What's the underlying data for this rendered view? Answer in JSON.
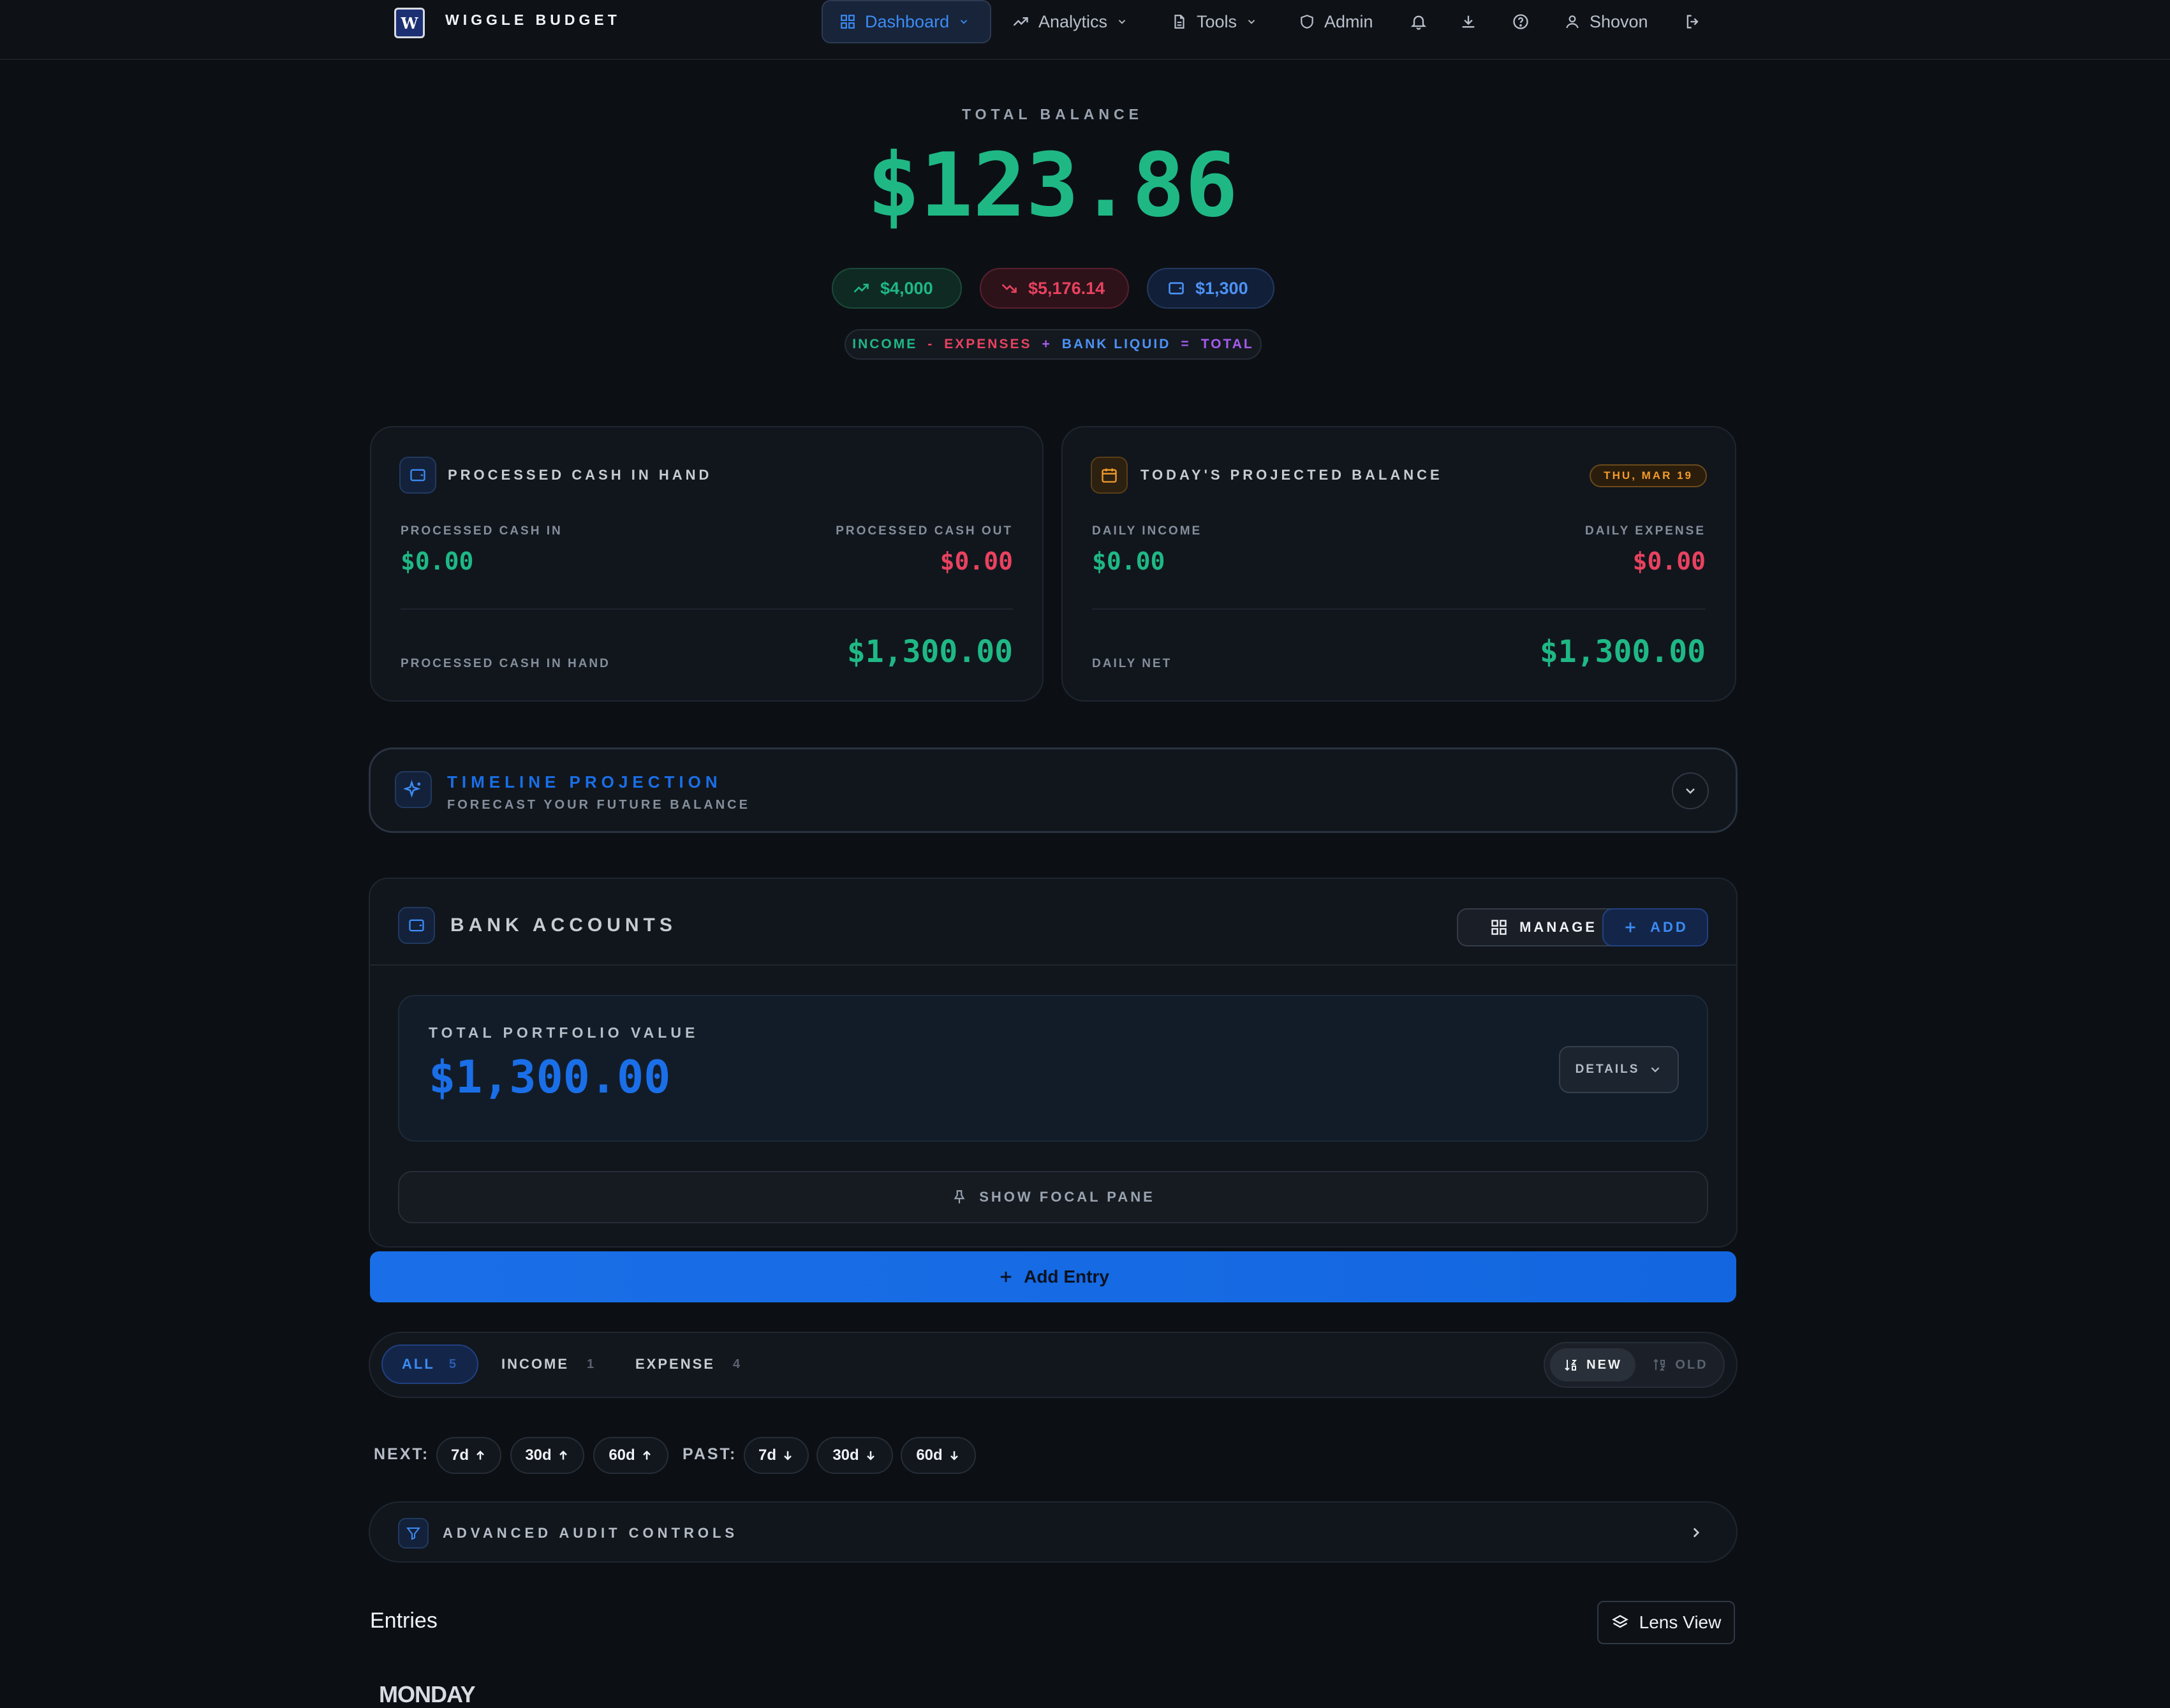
{
  "colors": {
    "accent_blue": "#1a6fe8",
    "income_green": "#1fb885",
    "expense_red": "#e8425f",
    "purple": "#a55cf0",
    "orange": "#f39b2c",
    "background": "#0c1015"
  },
  "nav": {
    "brand": "WIGGLE BUDGET",
    "logo_text": "W",
    "items": [
      {
        "label": "Dashboard",
        "icon": "grid-icon"
      },
      {
        "label": "Analytics",
        "icon": "trending-up-icon"
      },
      {
        "label": "Tools",
        "icon": "document-icon"
      },
      {
        "label": "Admin",
        "icon": "shield-icon"
      }
    ],
    "user": "Shovon"
  },
  "hero": {
    "label": "TOTAL BALANCE",
    "value": "$123.86",
    "pills": {
      "income": "$4,000",
      "expenses": "$5,176.14",
      "bank": "$1,300"
    },
    "formula": {
      "income": "INCOME",
      "minus": "-",
      "expenses": "EXPENSES",
      "plus": "+",
      "bank": "BANK LIQUID",
      "equals": "=",
      "total": "TOTAL"
    }
  },
  "cash_card": {
    "title": "PROCESSED CASH IN HAND",
    "in_label": "PROCESSED CASH IN",
    "in_value": "$0.00",
    "out_label": "PROCESSED CASH OUT",
    "out_value": "$0.00",
    "total_label": "PROCESSED CASH IN HAND",
    "total_value": "$1,300.00"
  },
  "projected_card": {
    "title": "TODAY'S PROJECTED BALANCE",
    "date_badge": "THU, MAR 19",
    "income_label": "DAILY INCOME",
    "income_value": "$0.00",
    "expense_label": "DAILY EXPENSE",
    "expense_value": "$0.00",
    "net_label": "DAILY NET",
    "net_value": "$1,300.00"
  },
  "timeline": {
    "title": "TIMELINE PROJECTION",
    "subtitle": "FORECAST YOUR FUTURE BALANCE"
  },
  "bank": {
    "title": "BANK ACCOUNTS",
    "manage_label": "MANAGE",
    "add_label": "ADD",
    "portfolio_label": "TOTAL PORTFOLIO VALUE",
    "portfolio_value": "$1,300.00",
    "details_label": "DETAILS",
    "focal_label": "SHOW FOCAL PANE"
  },
  "add_entry": "Add Entry",
  "filters": {
    "tabs": [
      {
        "label": "ALL",
        "count": "5"
      },
      {
        "label": "INCOME",
        "count": "1"
      },
      {
        "label": "EXPENSE",
        "count": "4"
      }
    ],
    "sort_new": "NEW",
    "sort_old": "OLD"
  },
  "quick_range": {
    "next_label": "NEXT:",
    "past_label": "PAST:",
    "next": [
      "7d",
      "30d",
      "60d"
    ],
    "past": [
      "7d",
      "30d",
      "60d"
    ]
  },
  "audit": {
    "title": "ADVANCED AUDIT CONTROLS"
  },
  "entries": {
    "title": "Entries",
    "lens_label": "Lens View",
    "day_heading": "MONDAY"
  }
}
